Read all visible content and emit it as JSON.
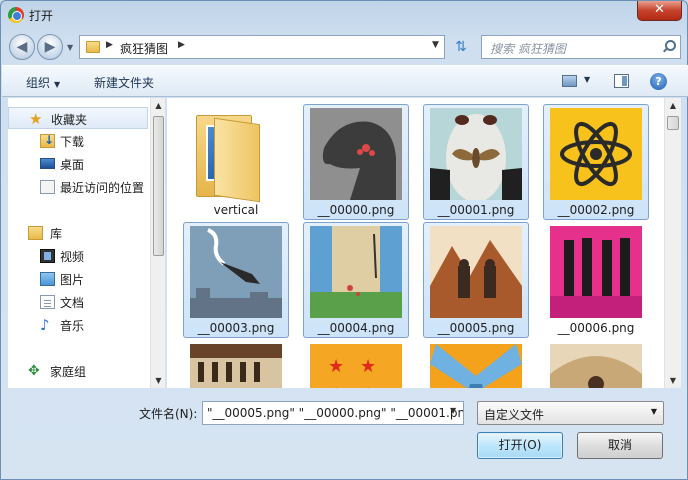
{
  "window": {
    "title": "打开",
    "close_glyph": "✕"
  },
  "nav": {
    "back_glyph": "◀",
    "forward_glyph": "▶",
    "breadcrumb": [
      "疯狂猜图"
    ],
    "search_placeholder": "搜索 疯狂猜图"
  },
  "toolbar": {
    "organize": "组织",
    "new_folder": "新建文件夹",
    "help_glyph": "?"
  },
  "sidebar": {
    "favorites": {
      "label": "收藏夹",
      "icon": "star-icon"
    },
    "items": [
      {
        "label": "下载",
        "icon": "downloads-icon"
      },
      {
        "label": "桌面",
        "icon": "desktop-icon"
      },
      {
        "label": "最近访问的位置",
        "icon": "recent-places-icon"
      }
    ],
    "libraries": {
      "label": "库",
      "icon": "library-icon"
    },
    "lib_items": [
      {
        "label": "视频",
        "icon": "video-icon"
      },
      {
        "label": "图片",
        "icon": "pictures-icon"
      },
      {
        "label": "文档",
        "icon": "documents-icon"
      },
      {
        "label": "音乐",
        "icon": "music-icon"
      }
    ],
    "homegroup": {
      "label": "家庭组",
      "icon": "homegroup-icon"
    }
  },
  "files": [
    {
      "name": "vertical",
      "type": "folder",
      "selected": false
    },
    {
      "name": "__00000.png",
      "type": "image",
      "selected": true
    },
    {
      "name": "__00001.png",
      "type": "image",
      "selected": true
    },
    {
      "name": "__00002.png",
      "type": "image",
      "selected": true
    },
    {
      "name": "__00003.png",
      "type": "image",
      "selected": true
    },
    {
      "name": "__00004.png",
      "type": "image",
      "selected": true
    },
    {
      "name": "__00005.png",
      "type": "image",
      "selected": true
    },
    {
      "name": "__00006.png",
      "type": "image",
      "selected": false
    }
  ],
  "footer": {
    "filename_label": "文件名(N):",
    "filename_value": "\"__00005.png\" \"__00000.png\" \"__00001.pn",
    "filetype_value": "自定义文件",
    "open_button": "打开(O)",
    "cancel_button": "取消"
  },
  "colors": {
    "selection": "#cde3f8",
    "selection_border": "#7da2ce",
    "accent": "#3c7fb1"
  }
}
